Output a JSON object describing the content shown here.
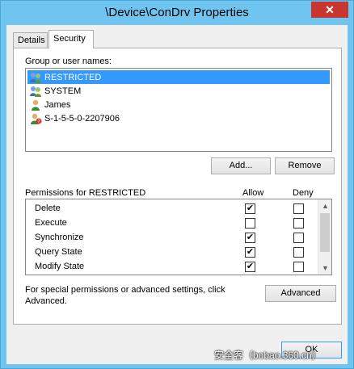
{
  "window": {
    "title": "\\Device\\ConDrv Properties",
    "close_glyph": "✕"
  },
  "tabs": [
    {
      "label": "Details"
    },
    {
      "label": "Security"
    }
  ],
  "security": {
    "group_label": "Group or user names:",
    "users": [
      {
        "name": "RESTRICTED",
        "icon": "group-icon",
        "selected": true
      },
      {
        "name": "SYSTEM",
        "icon": "group-icon",
        "selected": false
      },
      {
        "name": "James",
        "icon": "user-icon",
        "selected": false
      },
      {
        "name": "S-1-5-5-0-2207906",
        "icon": "unknown-user-icon",
        "selected": false
      }
    ],
    "add_label": "Add...",
    "remove_label": "Remove",
    "permissions_label": "Permissions for RESTRICTED",
    "allow_header": "Allow",
    "deny_header": "Deny",
    "permissions": [
      {
        "name": "Delete",
        "allow": true,
        "deny": false
      },
      {
        "name": "Execute",
        "allow": false,
        "deny": false
      },
      {
        "name": "Synchronize",
        "allow": true,
        "deny": false
      },
      {
        "name": "Query State",
        "allow": true,
        "deny": false
      },
      {
        "name": "Modify State",
        "allow": true,
        "deny": false
      }
    ],
    "special_text": "For special permissions or advanced settings, click Advanced.",
    "advanced_label": "Advanced",
    "check_glyph": "✔"
  },
  "footer": {
    "ok_label": "OK"
  },
  "watermark": "安全客（bobao.360.cn）",
  "colors": {
    "title_bar": "#6fc5f0",
    "selection": "#3399ff",
    "close_button": "#c7372f"
  }
}
